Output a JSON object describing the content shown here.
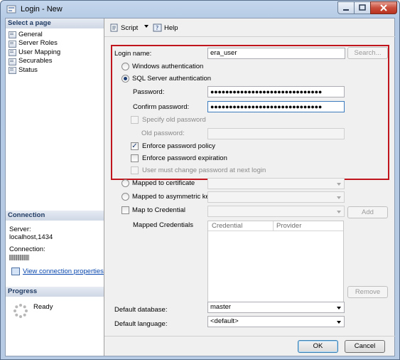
{
  "window": {
    "title": "Login - New"
  },
  "left": {
    "select_page_header": "Select a page",
    "pages": [
      "General",
      "Server Roles",
      "User Mapping",
      "Securables",
      "Status"
    ],
    "connection_header": "Connection",
    "server_label": "Server:",
    "server_value": "localhost,1434",
    "connection_label": "Connection:",
    "view_props_link": "View connection properties",
    "progress_header": "Progress",
    "progress_status": "Ready"
  },
  "toolbar": {
    "script_label": "Script",
    "help_label": "Help"
  },
  "form": {
    "login_name_label": "Login name:",
    "login_name_value": "era_user",
    "search_button": "Search...",
    "windows_auth": "Windows authentication",
    "sql_auth": "SQL Server authentication",
    "password_label": "Password:",
    "password_value": "●●●●●●●●●●●●●●●●●●●●●●●●●●●●●●",
    "confirm_label": "Confirm password:",
    "confirm_value": "●●●●●●●●●●●●●●●●●●●●●●●●●●●●●●",
    "specify_old": "Specify old password",
    "old_password_label": "Old password:",
    "enforce_policy": "Enforce password policy",
    "enforce_expiration": "Enforce password expiration",
    "must_change": "User must change password at next login",
    "mapped_cert": "Mapped to certificate",
    "mapped_asym": "Mapped to asymmetric key",
    "map_credential": "Map to Credential",
    "add_button": "Add",
    "mapped_credentials_label": "Mapped Credentials",
    "grid_columns": [
      "Credential",
      "Provider"
    ],
    "remove_button": "Remove",
    "default_db_label": "Default database:",
    "default_db_value": "master",
    "default_lang_label": "Default language:",
    "default_lang_value": "<default>"
  },
  "buttons": {
    "ok": "OK",
    "cancel": "Cancel"
  },
  "colors": {
    "highlight_border": "#c0151d",
    "link": "#0645ad",
    "panel_header": "#1f3a63"
  }
}
